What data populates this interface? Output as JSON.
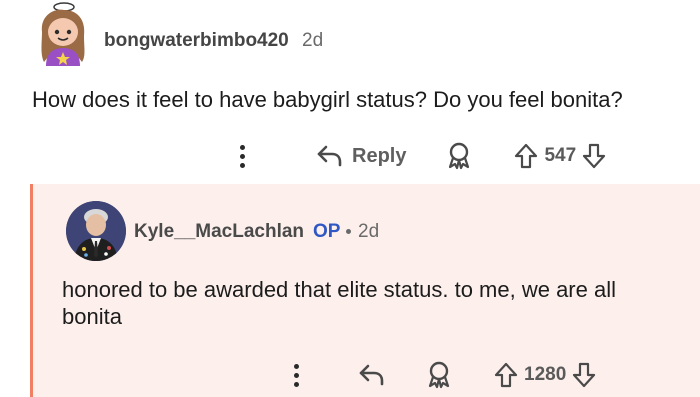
{
  "parent_comment": {
    "username": "bongwaterbimbo420",
    "age": "2d",
    "body": "How does it feel to have babygirl status? Do you feel bonita?",
    "actions": {
      "more_icon": "more-vertical-icon",
      "reply_icon": "reply-arrow-icon",
      "reply_label": "Reply",
      "award_icon": "award-icon",
      "upvote_icon": "upvote-arrow-icon",
      "score": "547",
      "downvote_icon": "downvote-arrow-icon"
    }
  },
  "reply_comment": {
    "username": "Kyle__MacLachlan",
    "op_badge": "OP",
    "age": "2d",
    "body": "honored to be awarded that elite status. to me, we are all bonita",
    "actions": {
      "more_icon": "more-vertical-icon",
      "reply_icon": "reply-arrow-icon",
      "award_icon": "award-icon",
      "upvote_icon": "upvote-arrow-icon",
      "score": "1280",
      "downvote_icon": "downvote-arrow-icon"
    }
  },
  "colors": {
    "thread_line": "#f07f63",
    "reply_background": "#fdf0ec",
    "op_badge": "#2f58c5"
  }
}
